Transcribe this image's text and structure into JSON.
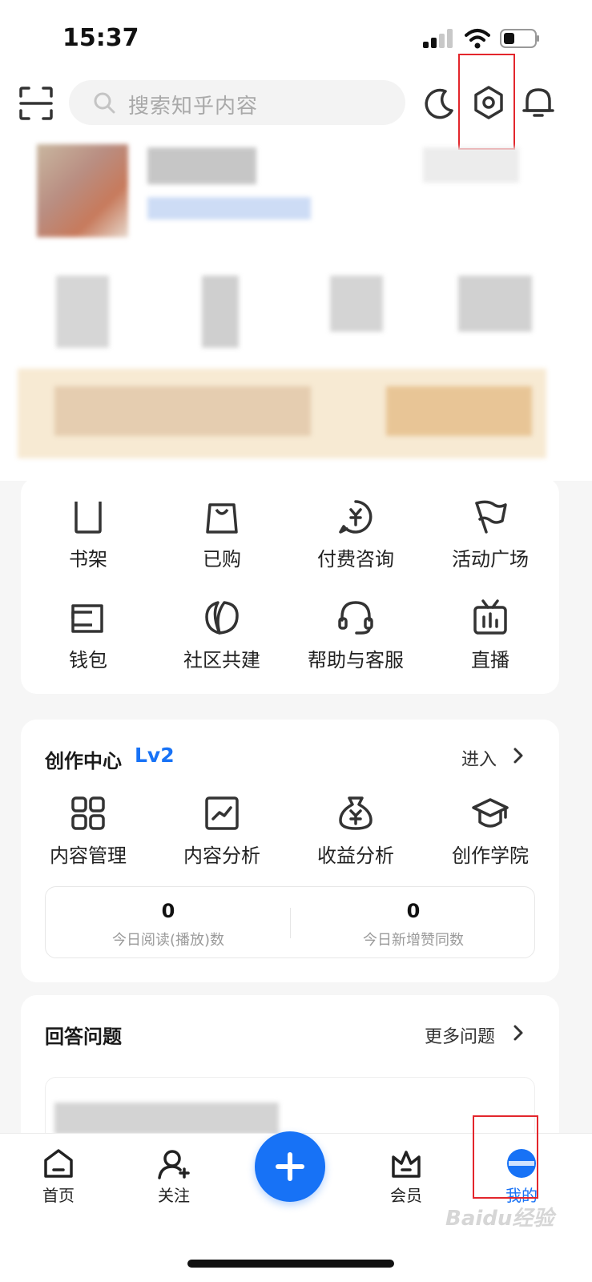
{
  "status_bar": {
    "time": "15:37"
  },
  "header": {
    "search_placeholder": "搜索知乎内容"
  },
  "quick_grid": [
    {
      "label": "书架",
      "icon": "bookshelf-icon"
    },
    {
      "label": "已购",
      "icon": "shopping-bag-icon"
    },
    {
      "label": "付费咨询",
      "icon": "paid-consult-icon"
    },
    {
      "label": "活动广场",
      "icon": "flag-icon"
    },
    {
      "label": "钱包",
      "icon": "wallet-icon"
    },
    {
      "label": "社区共建",
      "icon": "leaf-icon"
    },
    {
      "label": "帮助与客服",
      "icon": "headset-icon"
    },
    {
      "label": "直播",
      "icon": "live-tv-icon"
    }
  ],
  "creator_center": {
    "title": "创作中心",
    "level": "Lv2",
    "enter_label": "进入",
    "items": [
      {
        "label": "内容管理",
        "icon": "grid-icon"
      },
      {
        "label": "内容分析",
        "icon": "chart-icon"
      },
      {
        "label": "收益分析",
        "icon": "money-bag-icon"
      },
      {
        "label": "创作学院",
        "icon": "graduation-cap-icon"
      }
    ],
    "stats": [
      {
        "value": "0",
        "label": "今日阅读(播放)数"
      },
      {
        "value": "0",
        "label": "今日新增赞同数"
      }
    ]
  },
  "answer_questions": {
    "title": "回答问题",
    "more_label": "更多问题"
  },
  "tabbar": {
    "tabs": [
      {
        "label": "首页",
        "icon": "home-icon"
      },
      {
        "label": "关注",
        "icon": "follow-icon"
      },
      {
        "label": "会员",
        "icon": "vip-icon"
      },
      {
        "label": "我的",
        "icon": "profile-icon"
      }
    ]
  },
  "watermark": "Baidu经验",
  "colors": {
    "accent": "#1772f6",
    "highlight": "#e3262c"
  }
}
